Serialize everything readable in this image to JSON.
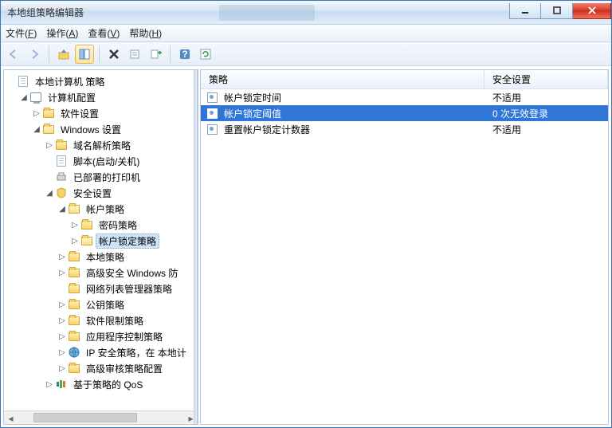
{
  "window": {
    "title": "本地组策略编辑器"
  },
  "menu": {
    "file": {
      "label": "文件",
      "key": "F"
    },
    "action": {
      "label": "操作",
      "key": "A"
    },
    "view": {
      "label": "查看",
      "key": "V"
    },
    "help": {
      "label": "帮助",
      "key": "H"
    }
  },
  "tree": {
    "root": "本地计算机 策略",
    "computer_config": "计算机配置",
    "software_settings": "软件设置",
    "windows_settings": "Windows 设置",
    "dns_policy": "域名解析策略",
    "scripts": "脚本(启动/关机)",
    "printers": "已部署的打印机",
    "security_settings": "安全设置",
    "account_policies": "帐户策略",
    "password_policy": "密码策略",
    "lockout_policy": "帐户锁定策略",
    "local_policies": "本地策略",
    "adv_windows_fw": "高级安全 Windows 防",
    "netlist": "网络列表管理器策略",
    "pubkey": "公钥策略",
    "software_restriction": "软件限制策略",
    "app_control": "应用程序控制策略",
    "ip_security": "IP 安全策略，在 本地计",
    "adv_audit": "高级审核策略配置",
    "qos": "基于策略的 QoS"
  },
  "list": {
    "cols": {
      "policy": "策略",
      "setting": "安全设置"
    },
    "rows": [
      {
        "name": "帐户锁定时间",
        "value": "不适用"
      },
      {
        "name": "帐户锁定阈值",
        "value": "0 次无效登录"
      },
      {
        "name": "重置帐户锁定计数器",
        "value": "不适用"
      }
    ]
  }
}
